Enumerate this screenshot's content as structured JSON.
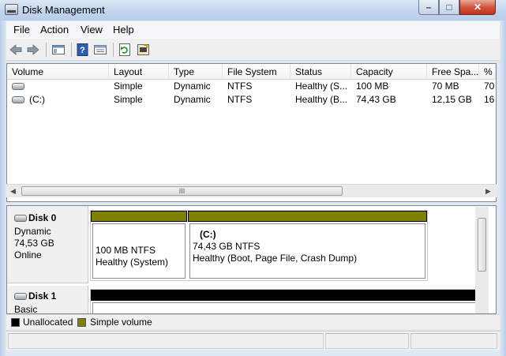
{
  "window": {
    "title": "Disk Management"
  },
  "menu": [
    "File",
    "Action",
    "View",
    "Help"
  ],
  "toolbar": {
    "buttons": [
      "back-arrow-icon",
      "forward-arrow-icon",
      "console-tree-icon",
      "help-icon",
      "properties-icon",
      "refresh-icon",
      "rescan-icon"
    ]
  },
  "volume_list": {
    "columns": [
      "Volume",
      "Layout",
      "Type",
      "File System",
      "Status",
      "Capacity",
      "Free Spa...",
      "% F"
    ],
    "rows": [
      [
        "",
        "Simple",
        "Dynamic",
        "NTFS",
        "Healthy (S...",
        "100 MB",
        "70 MB",
        "70"
      ],
      [
        "(C:)",
        "Simple",
        "Dynamic",
        "NTFS",
        "Healthy (B...",
        "74,43 GB",
        "12,15 GB",
        "16"
      ]
    ],
    "scroll_grip": "III"
  },
  "disks": [
    {
      "name": "Disk 0",
      "kind": "Dynamic",
      "size": "74,53 GB",
      "state": "Online",
      "partitions": [
        {
          "title": "",
          "line1": "100 MB NTFS",
          "line2": "Healthy (System)"
        },
        {
          "title": "(C:)",
          "line1": "74,43 GB NTFS",
          "line2": "Healthy (Boot, Page File, Crash Dump)"
        }
      ]
    },
    {
      "name": "Disk 1",
      "kind": "Basic"
    }
  ],
  "legend": [
    {
      "label": "Unallocated",
      "color": "#000000"
    },
    {
      "label": "Simple volume",
      "color": "#808000"
    }
  ]
}
